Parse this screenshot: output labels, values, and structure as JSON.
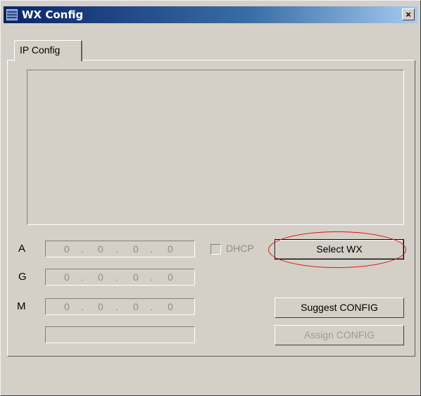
{
  "window": {
    "title": "WX Config",
    "close_symbol": "×"
  },
  "tabs": [
    {
      "label": "IP Config"
    }
  ],
  "fields": [
    {
      "label": "A",
      "octets": [
        "0",
        "0",
        "0",
        "0"
      ]
    },
    {
      "label": "G",
      "octets": [
        "0",
        "0",
        "0",
        "0"
      ]
    },
    {
      "label": "M",
      "octets": [
        "0",
        "0",
        "0",
        "0"
      ]
    }
  ],
  "ip_separator": ".",
  "extra_field": {
    "value": ""
  },
  "dhcp": {
    "label": "DHCP",
    "checked": false,
    "enabled": false
  },
  "buttons": {
    "select": "Select WX",
    "suggest": "Suggest CONFIG",
    "assign": "Assign CONFIG"
  },
  "colors": {
    "highlight_ellipse": "#e01010",
    "title_bar": "#0a246a"
  }
}
